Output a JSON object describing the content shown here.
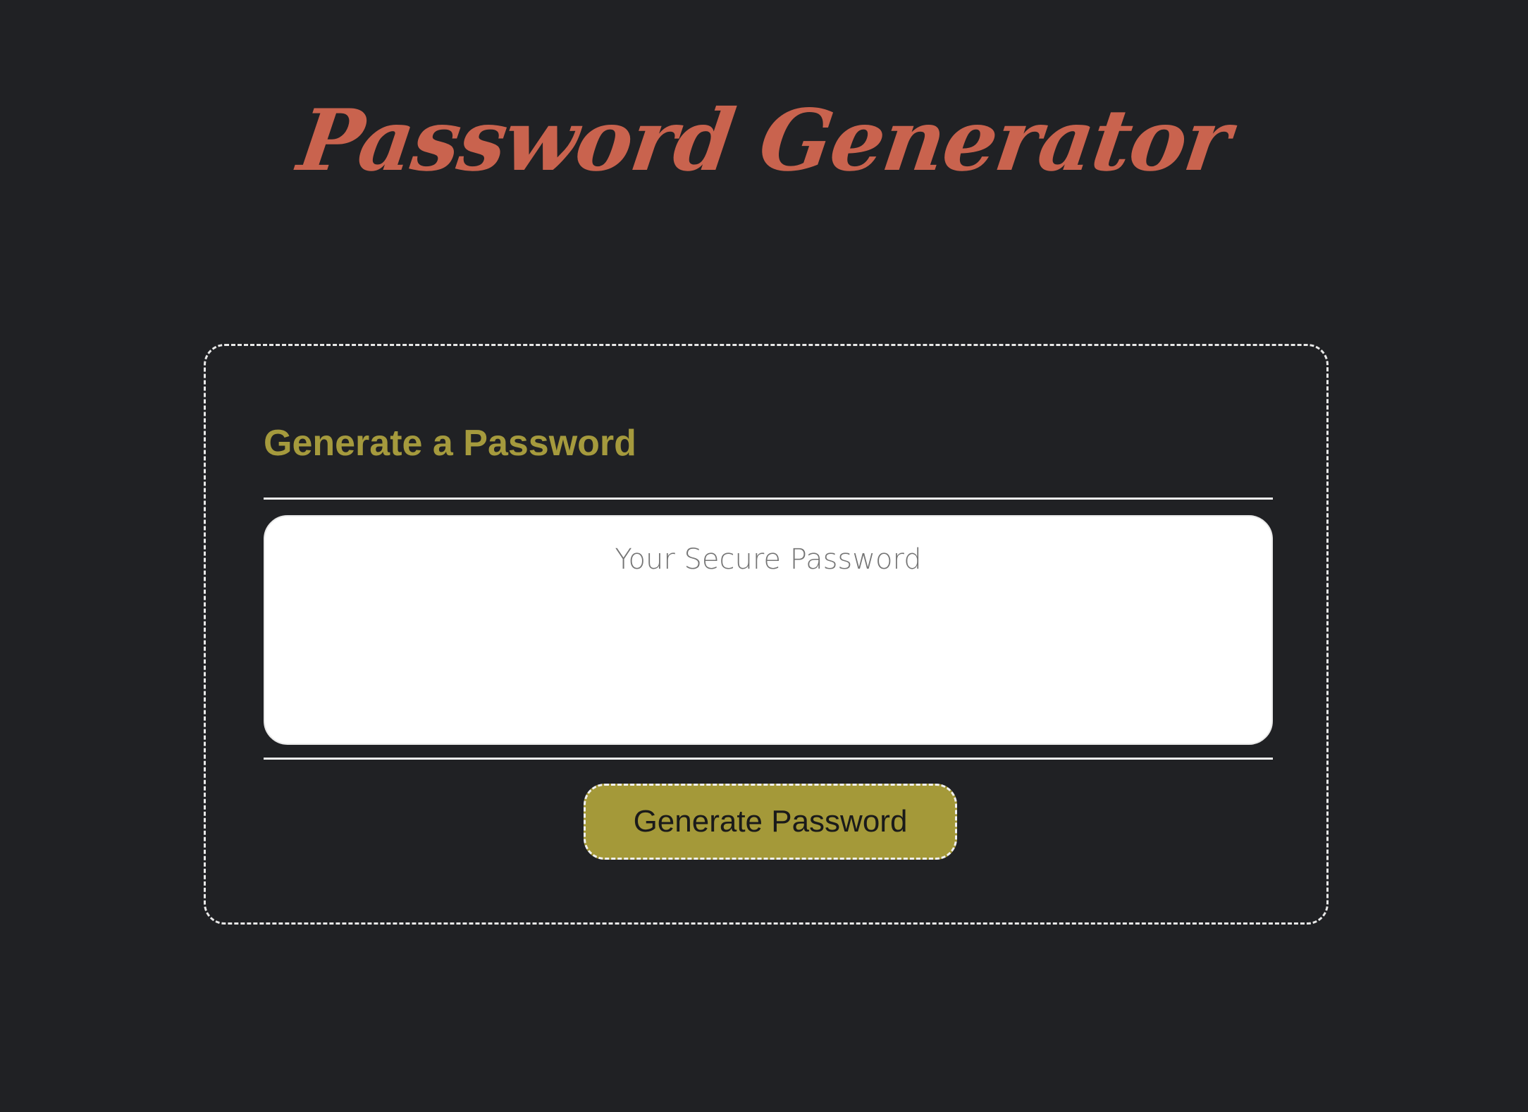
{
  "header": {
    "title": "Password Generator"
  },
  "card": {
    "header_title": "Generate a Password",
    "password_field": {
      "value": "",
      "placeholder": "Your Secure Password"
    },
    "generate_button_label": "Generate Password"
  },
  "colors": {
    "background": "#202124",
    "title": "#c9634e",
    "card_header": "#a59a3d",
    "button_background": "#a49939",
    "border": "#e8e8e8"
  }
}
